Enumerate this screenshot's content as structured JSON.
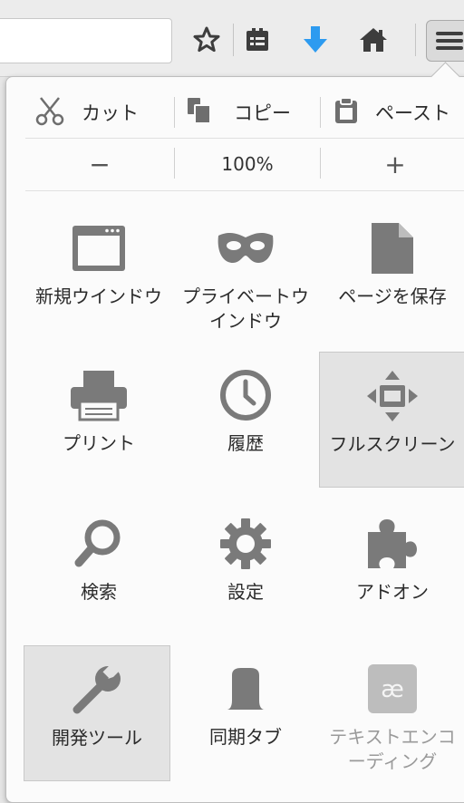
{
  "toolbar": {
    "icons": [
      "bookmark-star-icon",
      "bookmarks-list-icon",
      "download-arrow-icon",
      "home-icon",
      "hamburger-menu-icon"
    ],
    "accent_color": "#2d9bf0"
  },
  "edit_row": {
    "cut": "カット",
    "copy": "コピー",
    "paste": "ペースト"
  },
  "zoom_row": {
    "zoom_out": "−",
    "zoom_level": "100%",
    "zoom_in": "+"
  },
  "grid": {
    "new_window": "新規ウインドウ",
    "private_window": "プライベートウインドウ",
    "save_page": "ページを保存",
    "print": "プリント",
    "history": "履歴",
    "fullscreen": "フルスクリーン",
    "find": "検索",
    "settings": "設定",
    "addons": "アドオン",
    "developer": "開発ツール",
    "sync": "同期タブ",
    "text_encoding": "テキストエンコーディング"
  },
  "colors": {
    "icon_gray": "#7a7a7a",
    "panel_bg": "#fbfbfb",
    "active_bg": "#e3e3e3"
  }
}
